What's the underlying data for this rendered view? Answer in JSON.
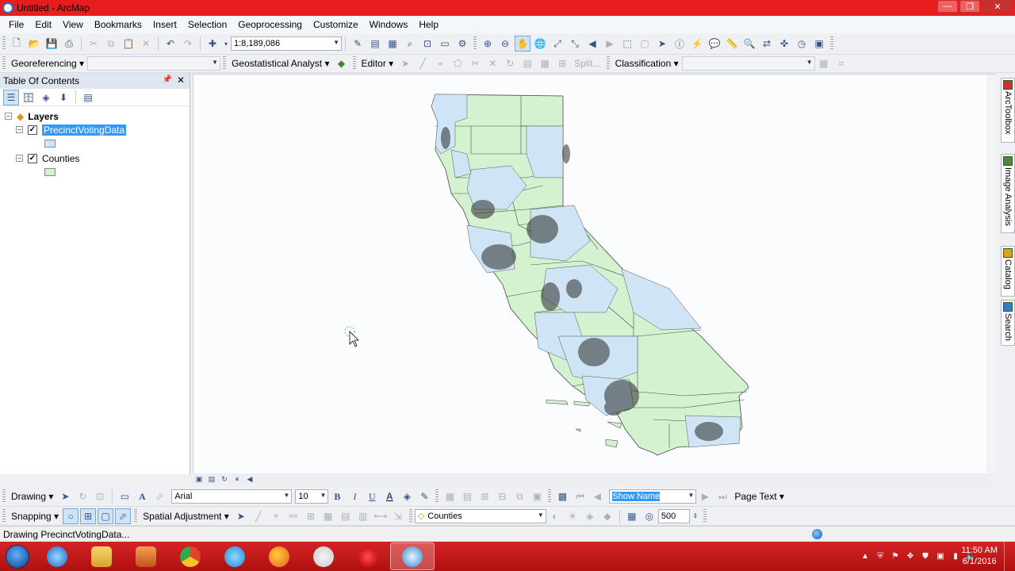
{
  "window": {
    "title": "Untitled - ArcMap",
    "controls": {
      "minimize": "—",
      "maximize": "❐",
      "close": "✕"
    }
  },
  "menu": [
    "File",
    "Edit",
    "View",
    "Bookmarks",
    "Insert",
    "Selection",
    "Geoprocessing",
    "Customize",
    "Windows",
    "Help"
  ],
  "standard_toolbar": {
    "scale": "1:8,189,086"
  },
  "toolbar2": {
    "georeferencing": "Georeferencing ▾",
    "geostatistical": "Geostatistical Analyst ▾",
    "editor": "Editor ▾",
    "split": "Split...",
    "classification": "Classification ▾"
  },
  "toc": {
    "title": "Table Of Contents",
    "root": "Layers",
    "layers": [
      {
        "name": "PrecinctVotingData",
        "checked": true,
        "selected": true,
        "swatch": "#cfe6f7"
      },
      {
        "name": "Counties",
        "checked": true,
        "selected": false,
        "swatch": "#d3f1cf"
      }
    ]
  },
  "map": {
    "county_fill": "#d4f2cf",
    "precinct_fill": "#cfe5f5",
    "outline": "#4a4a4a"
  },
  "dock_tabs": [
    "ArcToolbox",
    "Image Analysis",
    "Catalog",
    "Search"
  ],
  "drawing_toolbar": {
    "drawing": "Drawing ▾",
    "font": "Arial",
    "font_size": "10",
    "bold": "B",
    "italic": "I",
    "underline": "U",
    "text_color": "A",
    "show_name": "Show Name",
    "page_text": "Page Text ▾"
  },
  "snapping_toolbar": {
    "snapping": "Snapping ▾",
    "spatial_adjustment": "Spatial Adjustment ▾",
    "layer": "Counties",
    "value": "500"
  },
  "status": {
    "text": "Drawing PrecinctVotingData..."
  },
  "taskbar": {
    "time": "11:50 AM",
    "date": "6/1/2016",
    "apps": [
      "internet-explorer",
      "file-explorer",
      "media-player",
      "chrome",
      "skype",
      "firefox",
      "snipping-tool",
      "opera",
      "arcmap"
    ]
  }
}
